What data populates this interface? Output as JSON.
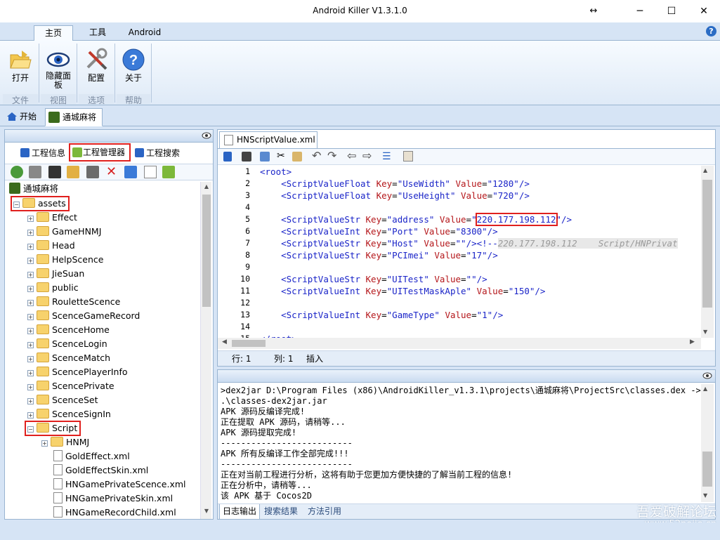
{
  "window": {
    "title": "Android Killer V1.3.1.0",
    "controls": {
      "restore_glyph": "↔",
      "minimize_glyph": "─",
      "maximize_glyph": "☐",
      "close_glyph": "✕"
    },
    "help_glyph": "?"
  },
  "ribbon_tabs": [
    "主页",
    "工具",
    "Android"
  ],
  "ribbon_buttons": [
    {
      "label": "打开",
      "icon": "folder-open-icon"
    },
    {
      "label": "隐藏面板",
      "label_line1": "隐藏面",
      "label_line2": "板",
      "icon": "eye-icon"
    },
    {
      "label": "配置",
      "icon": "tools-icon"
    },
    {
      "label": "关于",
      "icon": "help-icon"
    }
  ],
  "ribbon_groups": [
    "文件",
    "视图",
    "选项",
    "帮助"
  ],
  "doc_tabs": [
    {
      "label": "开始",
      "icon": "home-icon"
    },
    {
      "label": "通城麻将",
      "icon": "app-icon"
    }
  ],
  "left_panel": {
    "tabs": [
      "工程信息",
      "工程管理器",
      "工程搜索"
    ],
    "tree": {
      "root": "通城麻将",
      "assets": "assets",
      "assets_children": [
        "Effect",
        "GameHNMJ",
        "Head",
        "HelpScence",
        "JieSuan",
        "public",
        "RouletteScence",
        "ScenceGameRecord",
        "ScenceHome",
        "ScenceLogin",
        "ScenceMatch",
        "ScencePlayerInfo",
        "ScencePrivate",
        "ScenceSet",
        "ScenceSignIn"
      ],
      "script": "Script",
      "script_children": [
        {
          "name": "HNMJ",
          "type": "folder"
        },
        {
          "name": "GoldEffect.xml",
          "type": "file"
        },
        {
          "name": "GoldEffectSkin.xml",
          "type": "file"
        },
        {
          "name": "HNGamePrivateScence.xml",
          "type": "file"
        },
        {
          "name": "HNGamePrivateSkin.xml",
          "type": "file"
        },
        {
          "name": "HNGameRecordChild.xml",
          "type": "file"
        }
      ]
    }
  },
  "editor": {
    "tab": "HNScriptValue.xml",
    "line_numbers": [
      "1",
      "2",
      "3",
      "4",
      "5",
      "6",
      "7",
      "8",
      "9",
      "10",
      "11",
      "12",
      "13",
      "14",
      "15"
    ],
    "status": {
      "row_label": "行: 1",
      "col_label": "列: 1",
      "mode": "插入"
    }
  },
  "log": {
    "lines": [
      ">dex2jar D:\\Program Files (x86)\\AndroidKiller_v1.3.1\\projects\\通城麻将\\ProjectSrc\\classes.dex ->",
      ".\\classes-dex2jar.jar",
      "APK 源码反编译完成!",
      "正在提取 APK 源码，请稍等...",
      "APK 源码提取完成!",
      "--------------------------",
      "APK 所有反编译工作全部完成!!!",
      "--------------------------",
      "正在对当前工程进行分析，这将有助于您更加方便快捷的了解当前工程的信息!",
      "正在分析中，请稍等...",
      "该 APK 基于 Cocos2D"
    ],
    "tabs": [
      "日志输出",
      "搜索结果",
      "方法引用"
    ]
  },
  "watermark": {
    "line1": "吾爱破解论坛",
    "line2": "www.52pojie.cn"
  },
  "colors": {
    "highlight_box": "#e0201e",
    "tag": "#1a24c8",
    "attr": "#b4161a",
    "comment": "#9a9a9a"
  }
}
